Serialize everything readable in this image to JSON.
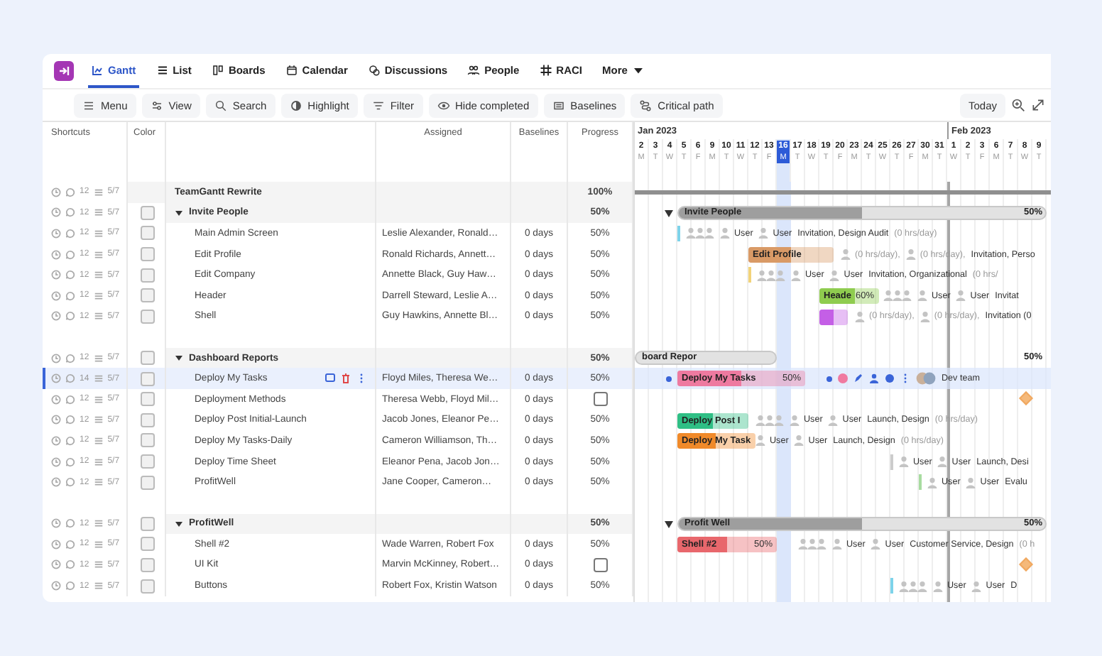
{
  "nav": {
    "tabs": [
      {
        "label": "Gantt",
        "selected": true
      },
      {
        "label": "List",
        "selected": false
      },
      {
        "label": "Boards",
        "selected": false
      },
      {
        "label": "Calendar",
        "selected": false
      },
      {
        "label": "Discussions",
        "selected": false
      },
      {
        "label": "People",
        "selected": false
      },
      {
        "label": "RACI",
        "selected": false
      },
      {
        "label": "More",
        "selected": false
      }
    ]
  },
  "toolbar": {
    "buttons": [
      "Menu",
      "View",
      "Search",
      "Highlight",
      "Filter",
      "Hide completed",
      "Baselines",
      "Critical path"
    ],
    "today": "Today"
  },
  "table": {
    "columns": [
      "Shortcuts",
      "Color",
      "Assigned",
      "Baselines",
      "Progress"
    ]
  },
  "timeline": {
    "months": [
      {
        "label": "Jan 2023",
        "days": [
          {
            "day": "2",
            "weekday": "M",
            "selected": false
          },
          {
            "day": "3",
            "weekday": "T",
            "selected": false
          },
          {
            "day": "4",
            "weekday": "W",
            "selected": false
          },
          {
            "day": "5",
            "weekday": "T",
            "selected": false
          },
          {
            "day": "6",
            "weekday": "F",
            "selected": false
          },
          {
            "day": "9",
            "weekday": "M",
            "selected": false
          },
          {
            "day": "10",
            "weekday": "T",
            "selected": false
          },
          {
            "day": "11",
            "weekday": "W",
            "selected": false
          },
          {
            "day": "12",
            "weekday": "T",
            "selected": false
          },
          {
            "day": "13",
            "weekday": "F",
            "selected": false
          },
          {
            "day": "16",
            "weekday": "M",
            "selected": true
          },
          {
            "day": "17",
            "weekday": "T",
            "selected": false
          },
          {
            "day": "18",
            "weekday": "W",
            "selected": false
          },
          {
            "day": "19",
            "weekday": "T",
            "selected": false
          },
          {
            "day": "20",
            "weekday": "F",
            "selected": false
          },
          {
            "day": "23",
            "weekday": "M",
            "selected": false
          },
          {
            "day": "24",
            "weekday": "T",
            "selected": false
          },
          {
            "day": "25",
            "weekday": "W",
            "selected": false
          },
          {
            "day": "26",
            "weekday": "T",
            "selected": false
          },
          {
            "day": "27",
            "weekday": "F",
            "selected": false
          },
          {
            "day": "30",
            "weekday": "M",
            "selected": false
          },
          {
            "day": "31",
            "weekday": "T",
            "selected": false
          }
        ]
      },
      {
        "label": "Feb 2023",
        "days": [
          {
            "day": "1",
            "weekday": "W",
            "selected": false
          },
          {
            "day": "2",
            "weekday": "T",
            "selected": false
          },
          {
            "day": "3",
            "weekday": "F",
            "selected": false
          },
          {
            "day": "6",
            "weekday": "M",
            "selected": false
          },
          {
            "day": "7",
            "weekday": "T",
            "selected": false
          },
          {
            "day": "8",
            "weekday": "W",
            "selected": false
          },
          {
            "day": "9",
            "weekday": "T",
            "selected": false
          }
        ]
      }
    ]
  },
  "rows": [
    {
      "kind": "project",
      "name": "TeamGantt Rewrite",
      "progress": "100%",
      "comments": "12",
      "checklist": "5/7",
      "selected": false,
      "timeline": {
        "kind": "project"
      }
    },
    {
      "kind": "group",
      "name": "Invite People",
      "progress": "50%",
      "comments": "12",
      "checklist": "5/7",
      "selected": false,
      "timeline": {
        "kind": "group",
        "label": "Invite People",
        "percent": "50%",
        "level": 0.5
      }
    },
    {
      "kind": "task",
      "name": "Main Admin Screen",
      "assigned": "Leslie Alexander, Ronald…",
      "baselines": "0 days",
      "progress": "50%",
      "comments": "12",
      "checklist": "5/7",
      "selected": false,
      "timeline": {
        "kind": "tick",
        "color": "#7dd3ea",
        "after": [
          {
            "kind": "avatars"
          },
          {
            "kind": "user",
            "text": "User"
          },
          {
            "kind": "user",
            "text": "User"
          },
          {
            "kind": "tags",
            "text": "Invitation, Design Audit"
          },
          {
            "kind": "hours",
            "text": "(0 hrs/day)"
          }
        ]
      }
    },
    {
      "kind": "task",
      "name": "Edit Profile",
      "assigned": "Ronald Richards, Annett…",
      "baselines": "0 days",
      "progress": "50%",
      "comments": "12",
      "checklist": "5/7",
      "selected": false,
      "timeline": {
        "kind": "bar",
        "label": "Edit Profile",
        "color": "#d99a66",
        "level": 0.5,
        "after": [
          {
            "kind": "user_hours",
            "text": "(0 hrs/day),"
          },
          {
            "kind": "user_hours",
            "text": "(0 hrs/day),"
          },
          {
            "kind": "tags",
            "text": "Invitation, Perso"
          }
        ]
      }
    },
    {
      "kind": "task",
      "name": "Edit Company",
      "assigned": "Annette Black, Guy Haw…",
      "baselines": "0 days",
      "progress": "50%",
      "comments": "12",
      "checklist": "5/7",
      "selected": false,
      "timeline": {
        "kind": "tick",
        "color": "#f2d37a",
        "after": [
          {
            "kind": "avatars"
          },
          {
            "kind": "user",
            "text": "User"
          },
          {
            "kind": "user",
            "text": "User"
          },
          {
            "kind": "tags",
            "text": "Invitation, Organizational"
          },
          {
            "kind": "hours",
            "text": "(0 hrs/"
          }
        ]
      }
    },
    {
      "kind": "task",
      "name": "Header",
      "assigned": "Darrell Steward, Leslie A…",
      "baselines": "0 days",
      "progress": "50%",
      "comments": "12",
      "checklist": "5/7",
      "selected": false,
      "timeline": {
        "kind": "bar",
        "label": "Heade",
        "percent": "60%",
        "color": "#8fcc4f",
        "level": 0.6,
        "after": [
          {
            "kind": "avatars"
          },
          {
            "kind": "user",
            "text": "User"
          },
          {
            "kind": "user",
            "text": "User"
          },
          {
            "kind": "tags",
            "text": "Invitat"
          }
        ]
      }
    },
    {
      "kind": "task",
      "name": "Shell",
      "assigned": "Guy Hawkins, Annette Bl…",
      "baselines": "0 days",
      "progress": "50%",
      "comments": "12",
      "checklist": "5/7",
      "selected": false,
      "timeline": {
        "kind": "bar",
        "color": "#c45fe6",
        "level": 0.5,
        "after": [
          {
            "kind": "user_hours",
            "text": "(0 hrs/day),"
          },
          {
            "kind": "user_hours",
            "text": "(0 hrs/day),"
          },
          {
            "kind": "tags",
            "text": "Invitation (0"
          }
        ]
      }
    },
    {
      "kind": "spacer"
    },
    {
      "kind": "group",
      "name": "Dashboard Reports",
      "progress": "50%",
      "comments": "12",
      "checklist": "5/7",
      "selected": false,
      "timeline": {
        "kind": "group",
        "label": "board Repor",
        "percent": "50%"
      }
    },
    {
      "kind": "task",
      "name": "Deploy My Tasks",
      "assigned": "Floyd Miles, Theresa We…",
      "baselines": "0 days",
      "progress": "50%",
      "comments": "14",
      "checklist": "5/7",
      "selected": true,
      "timeline": {
        "kind": "bar",
        "label": "Deploy My Tasks",
        "percent": "50%",
        "color": "#ee7aa0",
        "level": 0.5,
        "after": [
          {
            "kind": "actions"
          },
          {
            "kind": "team",
            "text": "Dev team"
          }
        ]
      }
    },
    {
      "kind": "task",
      "name": "Deployment Methods",
      "assigned": "Theresa Webb, Floyd Mil…",
      "baselines": "0 days",
      "complete": false,
      "comments": "12",
      "checklist": "5/7",
      "selected": false,
      "timeline": {
        "kind": "milestone",
        "color": "#f5b97a"
      }
    },
    {
      "kind": "task",
      "name": "Deploy Post Initial-Launch",
      "assigned": "Jacob Jones, Eleanor Pe…",
      "baselines": "0 days",
      "progress": "50%",
      "comments": "12",
      "checklist": "5/7",
      "selected": false,
      "timeline": {
        "kind": "bar",
        "label": "Deploy Post I",
        "color": "#2fbf85",
        "level": 0.5,
        "after": [
          {
            "kind": "avatars"
          },
          {
            "kind": "user",
            "text": "User"
          },
          {
            "kind": "user",
            "text": "User"
          },
          {
            "kind": "tags",
            "text": "Launch, Design"
          },
          {
            "kind": "hours",
            "text": "(0 hrs/day)"
          }
        ]
      }
    },
    {
      "kind": "task",
      "name": "Deploy My Tasks-Daily",
      "assigned": "Cameron Williamson, Th…",
      "baselines": "0 days",
      "progress": "50%",
      "comments": "12",
      "checklist": "5/7",
      "selected": false,
      "timeline": {
        "kind": "bar",
        "label": "Deploy My Task",
        "color": "#f08a2a",
        "level": 0.5,
        "after": [
          {
            "kind": "user",
            "text": "User"
          },
          {
            "kind": "user",
            "text": "User"
          },
          {
            "kind": "tags",
            "text": "Launch, Design"
          },
          {
            "kind": "hours",
            "text": "(0 hrs/day)"
          }
        ]
      }
    },
    {
      "kind": "task",
      "name": "Deploy Time Sheet",
      "assigned": "Eleanor Pena, Jacob Jon…",
      "baselines": "0 days",
      "progress": "50%",
      "comments": "12",
      "checklist": "5/7",
      "selected": false,
      "timeline": {
        "kind": "tick",
        "color": "#cccccc",
        "after": [
          {
            "kind": "user",
            "text": "User"
          },
          {
            "kind": "user",
            "text": "User"
          },
          {
            "kind": "tags",
            "text": "Launch, Desi"
          }
        ]
      }
    },
    {
      "kind": "task",
      "name": "ProfitWell",
      "assigned": "Jane Cooper, Cameron…",
      "baselines": "0 days",
      "progress": "50%",
      "comments": "12",
      "checklist": "5/7",
      "selected": false,
      "timeline": {
        "kind": "tick",
        "color": "#a8dca0",
        "after": [
          {
            "kind": "user",
            "text": "User"
          },
          {
            "kind": "user",
            "text": "User"
          },
          {
            "kind": "tags",
            "text": "Evalu"
          }
        ]
      }
    },
    {
      "kind": "spacer"
    },
    {
      "kind": "group",
      "name": "ProfitWell",
      "progress": "50%",
      "comments": "12",
      "checklist": "5/7",
      "selected": false,
      "timeline": {
        "kind": "group",
        "label": "Profit Well",
        "percent": "50%",
        "level": 0.5
      }
    },
    {
      "kind": "task",
      "name": "Shell #2",
      "assigned": "Wade Warren, Robert Fox",
      "baselines": "0 days",
      "progress": "50%",
      "comments": "12",
      "checklist": "5/7",
      "selected": false,
      "timeline": {
        "kind": "bar",
        "label": "Shell #2",
        "percent": "50%",
        "color": "#e8676c",
        "level": 0.5,
        "after": [
          {
            "kind": "avatars"
          },
          {
            "kind": "user",
            "text": "User"
          },
          {
            "kind": "user",
            "text": "User"
          },
          {
            "kind": "tags",
            "text": "Customer Service, Design"
          },
          {
            "kind": "hours",
            "text": "(0 h"
          }
        ]
      }
    },
    {
      "kind": "task",
      "name": "UI Kit",
      "assigned": "Marvin McKinney, Robert…",
      "baselines": "0 days",
      "complete": false,
      "comments": "12",
      "checklist": "5/7",
      "selected": false,
      "timeline": {
        "kind": "milestone",
        "color": "#f5b97a"
      }
    },
    {
      "kind": "task",
      "name": "Buttons",
      "assigned": "Robert Fox, Kristin Watson",
      "baselines": "0 days",
      "progress": "50%",
      "comments": "12",
      "checklist": "5/7",
      "selected": false,
      "timeline": {
        "kind": "tick",
        "color": "#7dd3ea",
        "after": [
          {
            "kind": "avatars"
          },
          {
            "kind": "user",
            "text": "User"
          },
          {
            "kind": "user",
            "text": "User"
          },
          {
            "kind": "tags",
            "text": "D"
          }
        ]
      }
    }
  ]
}
